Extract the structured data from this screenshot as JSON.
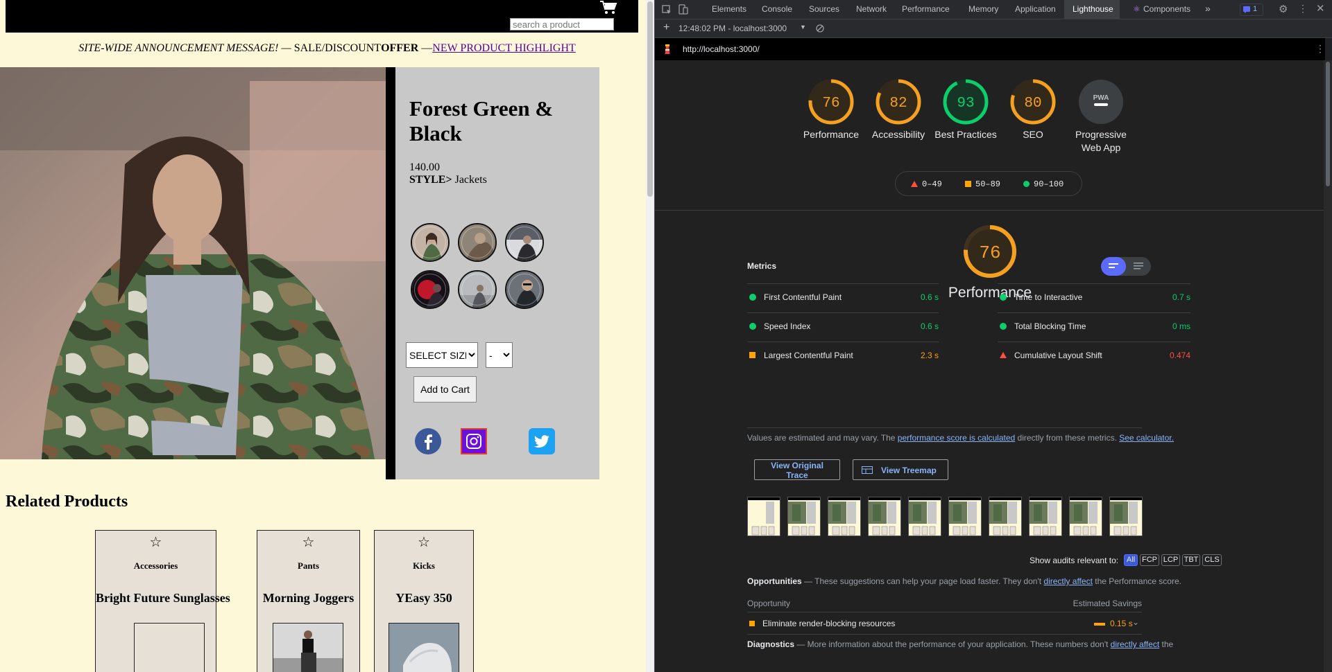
{
  "site": {
    "search_placeholder": "search a product",
    "announcement": {
      "part1": "SITE-WIDE ANNOUNCEMENT MESSAGE! —",
      "part2": " SALE/DISCOUNT",
      "part3": "OFFER",
      "part4": " —",
      "link": "NEW PRODUCT HIGHLIGHT"
    },
    "product": {
      "title": "Forest Green & Black",
      "price": "140.00",
      "style_label": "STYLE>",
      "style_value": " Jackets",
      "size_select": "SELECT SIZE",
      "qty_select": "-",
      "add_to_cart": "Add to Cart"
    },
    "related_title": "Related Products",
    "related": [
      {
        "category": "Accessories",
        "name": "Bright Future Sunglasses"
      },
      {
        "category": "Pants",
        "name": "Morning Joggers"
      },
      {
        "category": "Kicks",
        "name": "YEasy 350"
      }
    ],
    "colors": {
      "background": "#fdf8d8",
      "panel": "#c8c8c8",
      "card": "#e6e0d6",
      "link": "#5a0096"
    }
  },
  "devtools": {
    "tabs": [
      "Elements",
      "Console",
      "Sources",
      "Network",
      "Performance",
      "Memory",
      "Application",
      "Lighthouse",
      "Components"
    ],
    "active_tab": "Lighthouse",
    "issues_count": "1",
    "report_selector": "12:48:02 PM - localhost:3000",
    "url": "http://localhost:3000/",
    "scores": [
      {
        "label": "Performance",
        "score": 76,
        "color": "#f4a020"
      },
      {
        "label": "Accessibility",
        "score": 82,
        "color": "#f4a020"
      },
      {
        "label": "Best Practices",
        "score": 93,
        "color": "#0cce6b"
      },
      {
        "label": "SEO",
        "score": 80,
        "color": "#f4a020"
      },
      {
        "label": "Progressive Web App",
        "score": null,
        "badge": "PWA"
      }
    ],
    "legend": {
      "fail": "0–49",
      "average": "50–89",
      "pass": "90–100"
    },
    "perf": {
      "score": 76,
      "title": "Performance",
      "metrics_title": "Metrics",
      "metrics": [
        {
          "name": "First Contentful Paint",
          "value": "0.6 s",
          "status": "pass"
        },
        {
          "name": "Time to Interactive",
          "value": "0.7 s",
          "status": "pass"
        },
        {
          "name": "Speed Index",
          "value": "0.6 s",
          "status": "pass"
        },
        {
          "name": "Total Blocking Time",
          "value": "0 ms",
          "status": "pass"
        },
        {
          "name": "Largest Contentful Paint",
          "value": "2.3 s",
          "status": "average"
        },
        {
          "name": "Cumulative Layout Shift",
          "value": "0.474",
          "status": "fail"
        }
      ],
      "note_pre": "Values are estimated and may vary. The ",
      "note_link": "performance score is calculated",
      "note_mid": " directly from these metrics. ",
      "note_link2": "See calculator.",
      "view_trace": "View Original Trace",
      "view_treemap": "View Treemap",
      "show_audits": "Show audits relevant to:",
      "filters": [
        "All",
        "FCP",
        "LCP",
        "TBT",
        "CLS"
      ],
      "opportunities_title": "Opportunities",
      "opportunities_desc": " — These suggestions can help your page load faster. They don't ",
      "opportunities_link": "directly affect",
      "opportunities_tail": " the Performance score.",
      "col_opportunity": "Opportunity",
      "col_savings": "Estimated Savings",
      "opportunity_item": "Eliminate render-blocking resources",
      "opportunity_savings": "0.15 s",
      "diagnostics_title": "Diagnostics",
      "diagnostics_desc": " — More information about the performance of your application. These numbers don't ",
      "diagnostics_link": "directly affect",
      "diagnostics_tail": " the"
    }
  }
}
